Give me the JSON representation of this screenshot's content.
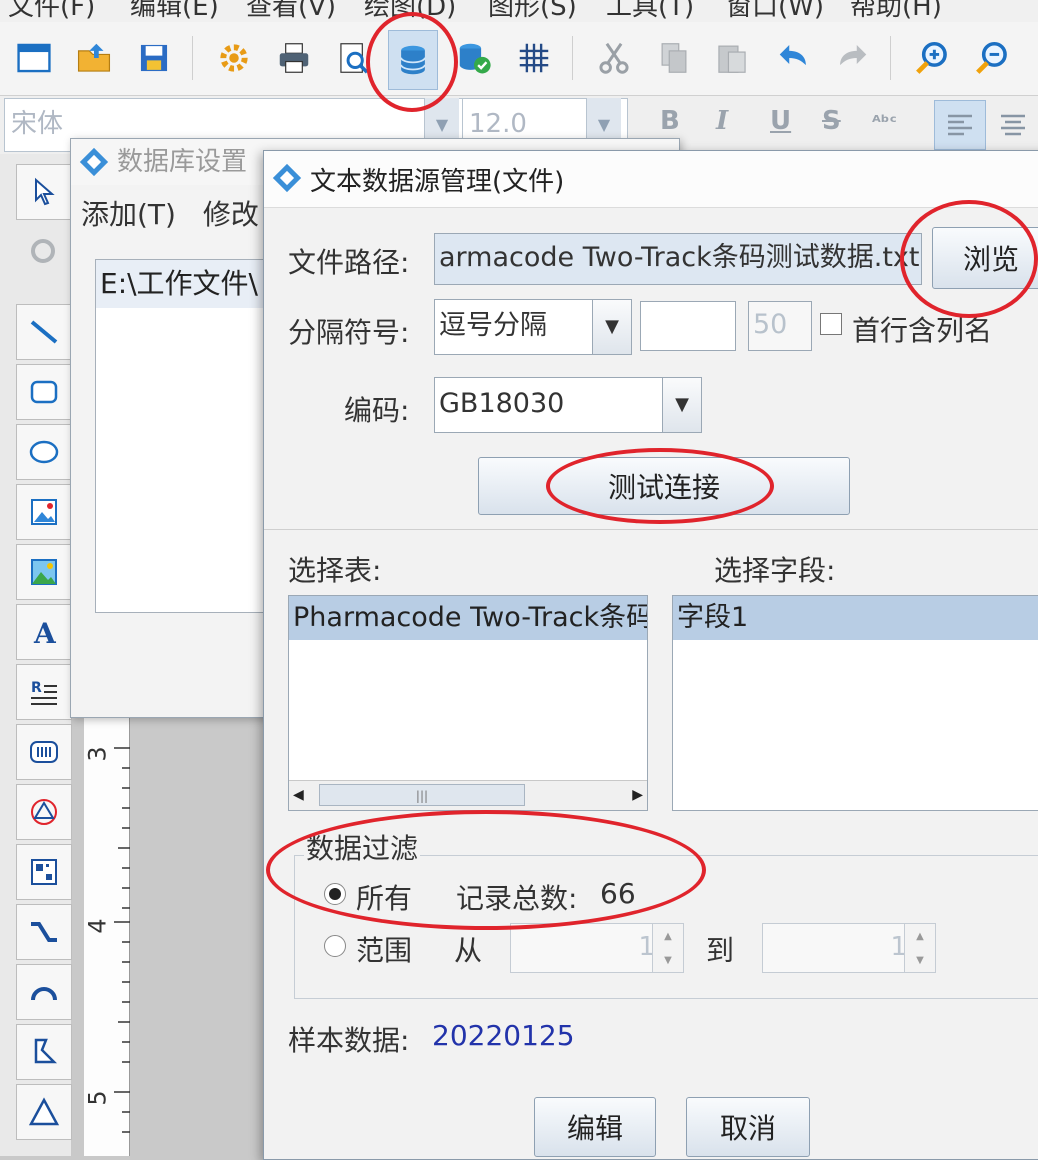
{
  "app_menu": [
    "文件(F)",
    "编辑(E)",
    "查看(V)",
    "绘图(D)",
    "图形(S)",
    "工具(T)",
    "窗口(W)",
    "帮助(H)"
  ],
  "format_bar": {
    "font_name": "宋体",
    "font_size": "12.0",
    "buttons": [
      "B",
      "I",
      "U",
      "S",
      "ᴬᵇᶜ"
    ]
  },
  "ruler_numbers": [
    "3",
    "4",
    "5"
  ],
  "db_dialog": {
    "title": "数据库设置",
    "menu_add": "添加(T)",
    "menu_edit": "修改",
    "list_item": "E:\\工作文件\\"
  },
  "ds_dialog": {
    "title": "文本数据源管理(文件)",
    "file_path_label": "文件路径:",
    "file_path_value": "armacode Two-Track条码测试数据.txt",
    "browse_label": "浏览",
    "separator_label": "分隔符号:",
    "separator_value": "逗号分隔",
    "separator_count": "50",
    "first_row_label": "首行含列名",
    "encoding_label": "编码:",
    "encoding_value": "GB18030",
    "test_button": "测试连接",
    "select_table_label": "选择表:",
    "select_field_label": "选择字段:",
    "table_item": "Pharmacode Two-Track条码",
    "field_item": "字段1",
    "filter_group": "数据过滤",
    "radio_all": "所有",
    "record_total_label": "记录总数:",
    "record_total_value": "66",
    "radio_range": "范围",
    "from_label": "从",
    "from_value": "1",
    "to_label": "到",
    "to_value": "1",
    "sample_label": "样本数据:",
    "sample_value": "20220125",
    "edit_button": "编辑",
    "cancel_button": "取消"
  },
  "colors": {
    "annotation": "#e0242c",
    "sample_value": "#2233aa",
    "selection": "#b8cde4"
  }
}
